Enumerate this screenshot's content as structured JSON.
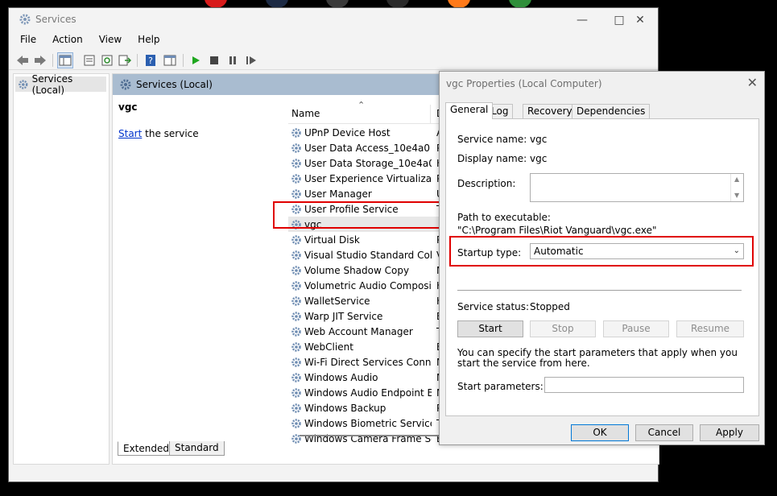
{
  "colors": {
    "highlight_red": "#e00000",
    "header_blue": "#a9bcd0",
    "link_blue": "#0033cc"
  },
  "main_window": {
    "title": "Services",
    "menu": [
      "File",
      "Action",
      "View",
      "Help"
    ],
    "tree": {
      "root": "Services (Local)"
    },
    "content_header": "Services (Local)",
    "selected_service": "vgc",
    "action_link": "Start",
    "action_suffix": " the service",
    "columns": {
      "name": "Name",
      "description": "D"
    },
    "rows": [
      {
        "name": "UPnP Device Host",
        "desc": "A"
      },
      {
        "name": "User Data Access_10e4a0",
        "desc": "P"
      },
      {
        "name": "User Data Storage_10e4a0",
        "desc": "H"
      },
      {
        "name": "User Experience Virtualizati...",
        "desc": "P"
      },
      {
        "name": "User Manager",
        "desc": "U"
      },
      {
        "name": "User Profile Service",
        "desc": "T"
      },
      {
        "name": "vgc",
        "desc": ""
      },
      {
        "name": "Virtual Disk",
        "desc": "P"
      },
      {
        "name": "Visual Studio Standard Coll...",
        "desc": "V"
      },
      {
        "name": "Volume Shadow Copy",
        "desc": "M"
      },
      {
        "name": "Volumetric Audio Composit...",
        "desc": "H"
      },
      {
        "name": "WalletService",
        "desc": "H"
      },
      {
        "name": "Warp JIT Service",
        "desc": "E"
      },
      {
        "name": "Web Account Manager",
        "desc": "T"
      },
      {
        "name": "WebClient",
        "desc": "E"
      },
      {
        "name": "Wi-Fi Direct Services Conne...",
        "desc": "M"
      },
      {
        "name": "Windows Audio",
        "desc": "M"
      },
      {
        "name": "Windows Audio Endpoint B...",
        "desc": "M"
      },
      {
        "name": "Windows Backup",
        "desc": "P"
      },
      {
        "name": "Windows Biometric Service",
        "desc": "T"
      },
      {
        "name": "Windows Camera Frame Se...",
        "desc": "E"
      }
    ],
    "bottom_tabs": [
      "Extended",
      "Standard"
    ]
  },
  "dialog": {
    "title": "vgc Properties (Local Computer)",
    "tabs": [
      "General",
      "Log On",
      "Recovery",
      "Dependencies"
    ],
    "service_name_label": "Service name:",
    "service_name": "vgc",
    "display_name_label": "Display name:",
    "display_name": "vgc",
    "description_label": "Description:",
    "path_label": "Path to executable:",
    "path": "\"C:\\Program Files\\Riot Vanguard\\vgc.exe\"",
    "startup_label": "Startup type:",
    "startup_value": "Automatic",
    "status_label": "Service status:",
    "status_value": "Stopped",
    "buttons": {
      "start": "Start",
      "stop": "Stop",
      "pause": "Pause",
      "resume": "Resume"
    },
    "hint": "You can specify the start parameters that apply when you start the service from here.",
    "params_label": "Start parameters:",
    "ok": "OK",
    "cancel": "Cancel",
    "apply": "Apply"
  }
}
